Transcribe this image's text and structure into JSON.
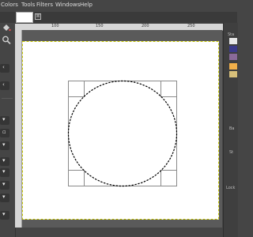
{
  "menubar": {
    "items": [
      {
        "label": "Colors"
      },
      {
        "label": "Tools"
      },
      {
        "label": "Filters"
      },
      {
        "label": "Windows"
      },
      {
        "label": "Help"
      }
    ]
  },
  "image_tab": {
    "close_glyph": "⊠"
  },
  "ruler": {
    "top_ticks": [
      "100",
      "150",
      "200",
      "250"
    ]
  },
  "toolbox": {
    "icons": [
      "bucket-fill-icon",
      "magnify-icon"
    ],
    "collapsed_glyph": "‹"
  },
  "dock": {
    "label_sta": "Sta",
    "label_ba": "Ba",
    "label_st": "St",
    "label_lock": "Lock",
    "swatches": [
      "#e8e8e8",
      "#3b3a8a",
      "#8a6a9a",
      "#f2b04a",
      "#d8c07a"
    ]
  },
  "canvas": {
    "background": "#ffffff",
    "selection": "ellipse"
  }
}
